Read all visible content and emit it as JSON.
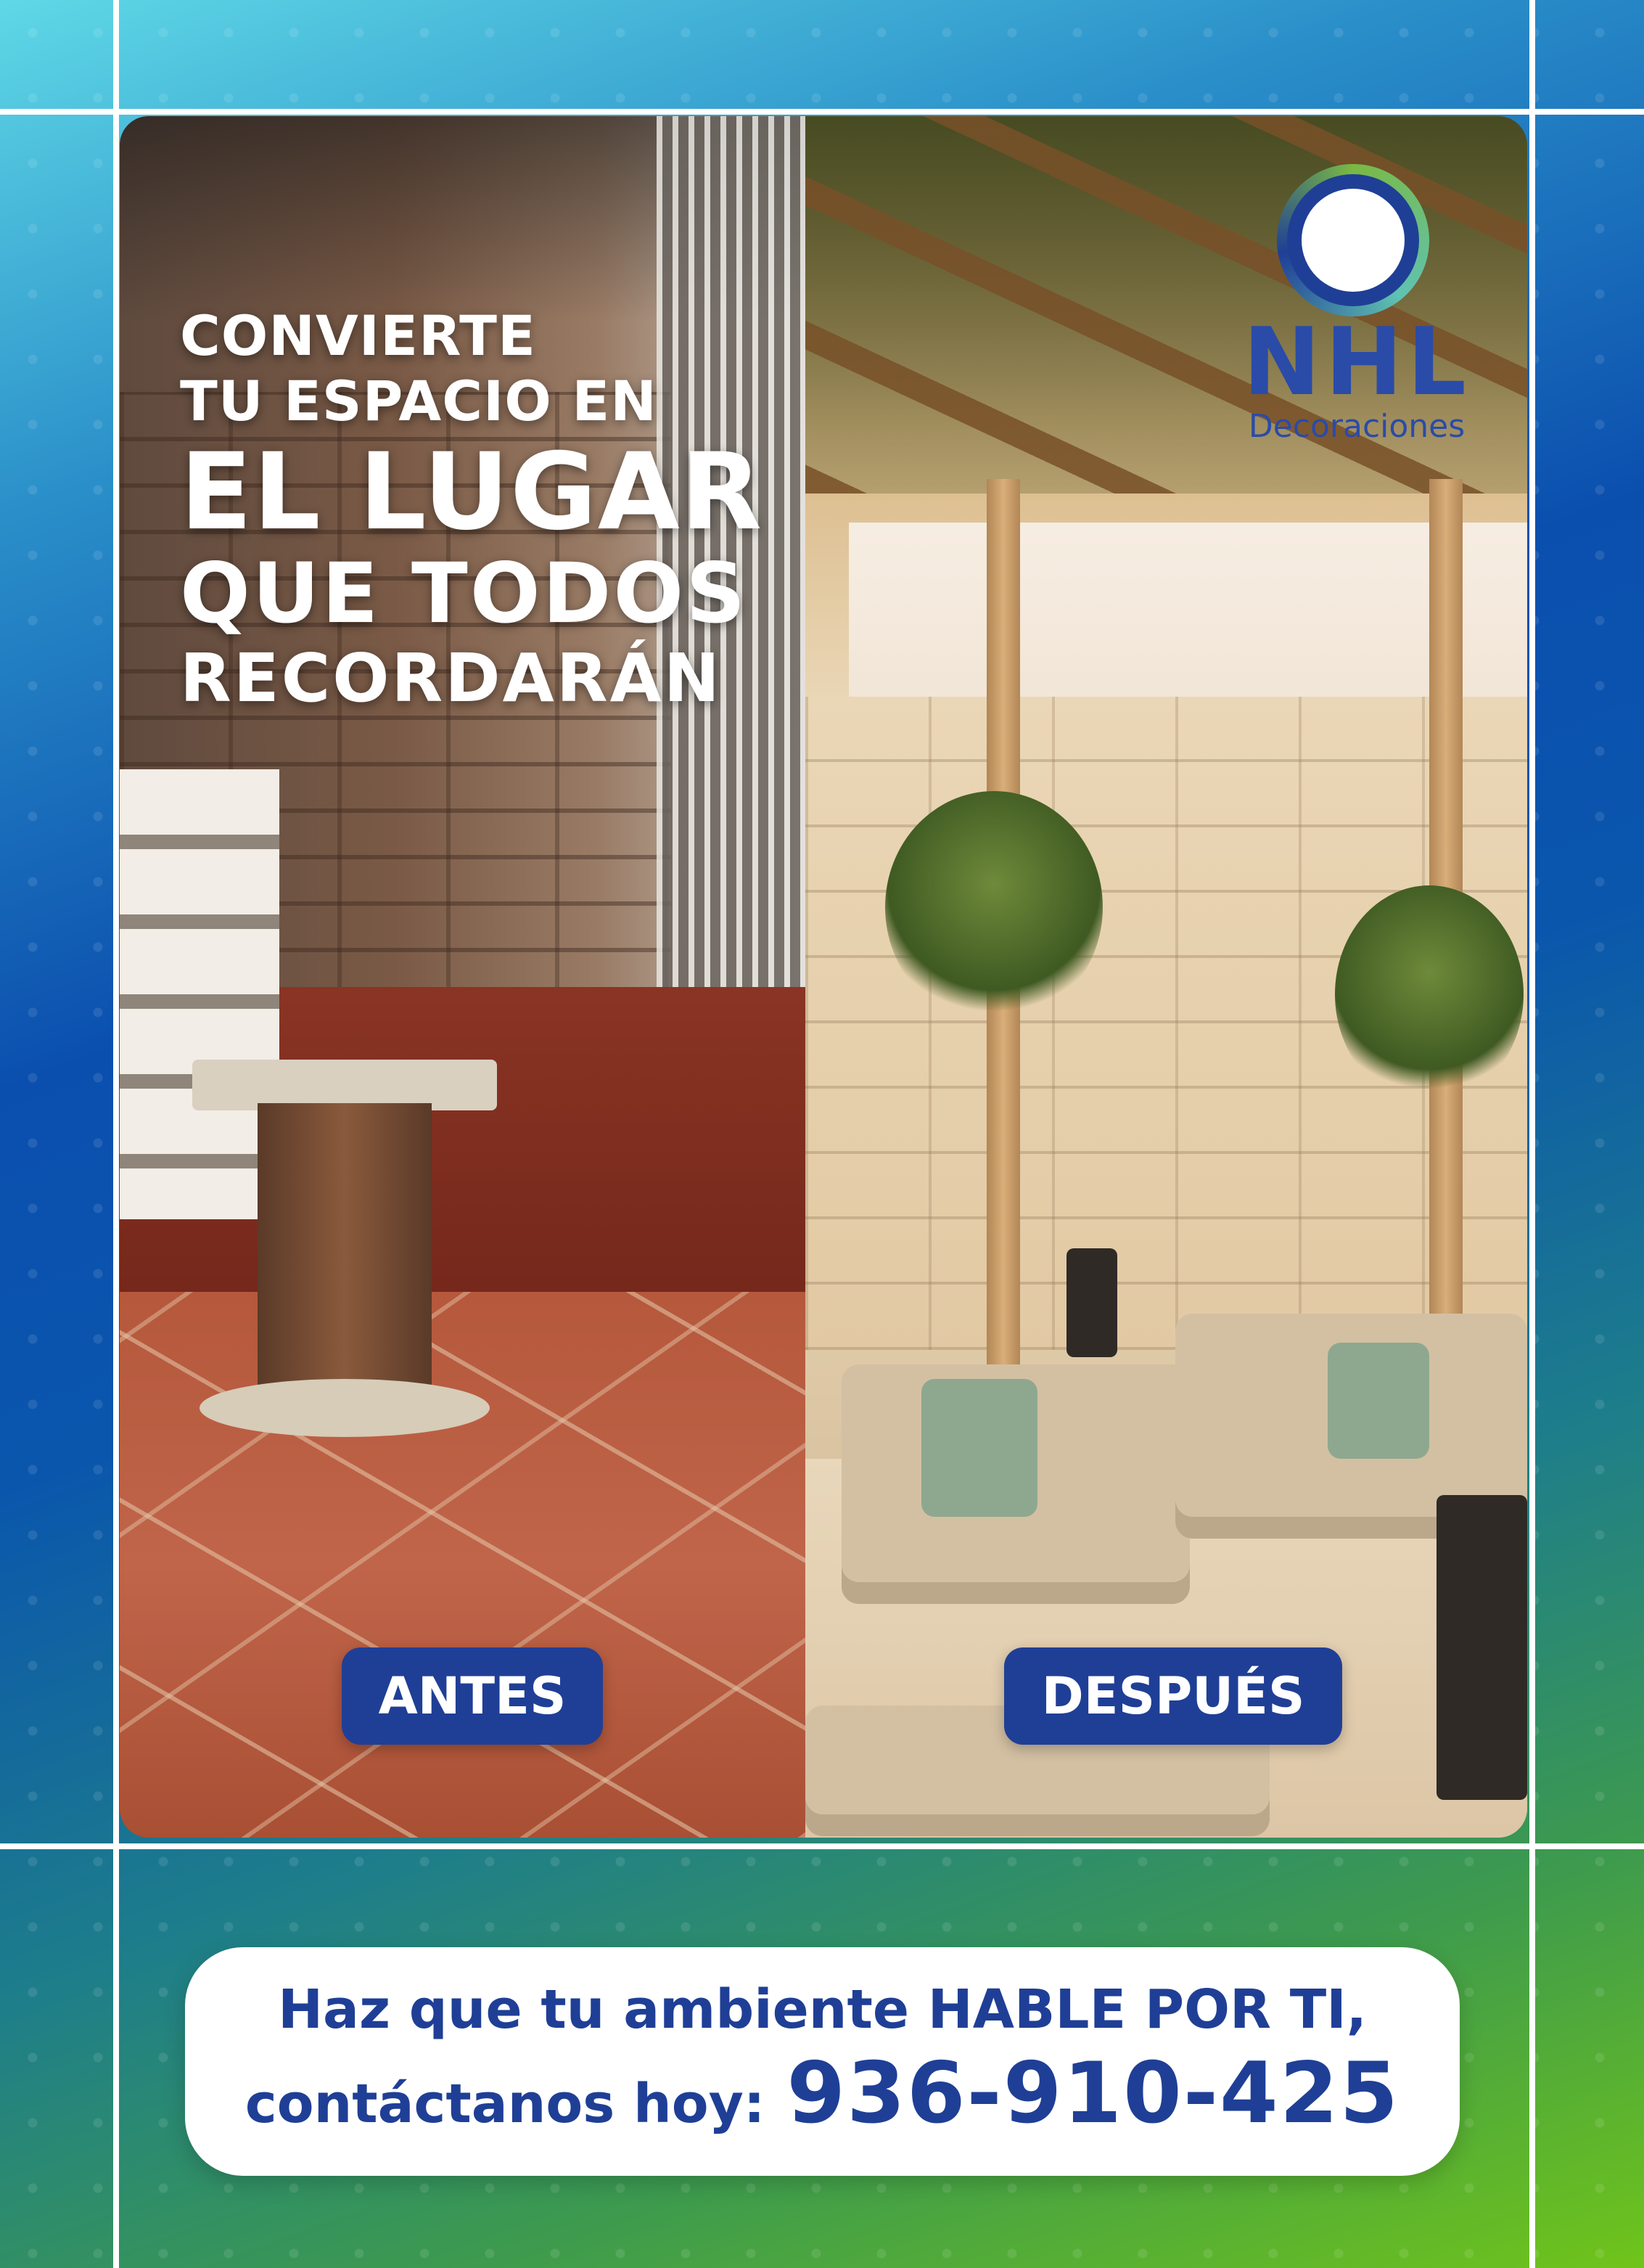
{
  "headline": {
    "line1": "CONVIERTE",
    "line2": "TU ESPACIO EN",
    "line3": "EL LUGAR",
    "line4": "QUE TODOS",
    "line5": "RECORDARÁN"
  },
  "labels": {
    "before": "ANTES",
    "after": "DESPUÉS"
  },
  "logo": {
    "brand": "NHL",
    "subtitle": "Decoraciones"
  },
  "cta": {
    "line1": "Haz que tu ambiente HABLE POR TI,",
    "line2_prefix": "contáctanos hoy:",
    "phone": "936-910-425"
  },
  "colors": {
    "brand_blue": "#1f3f96",
    "brand_green": "#7ab943",
    "white": "#ffffff"
  }
}
